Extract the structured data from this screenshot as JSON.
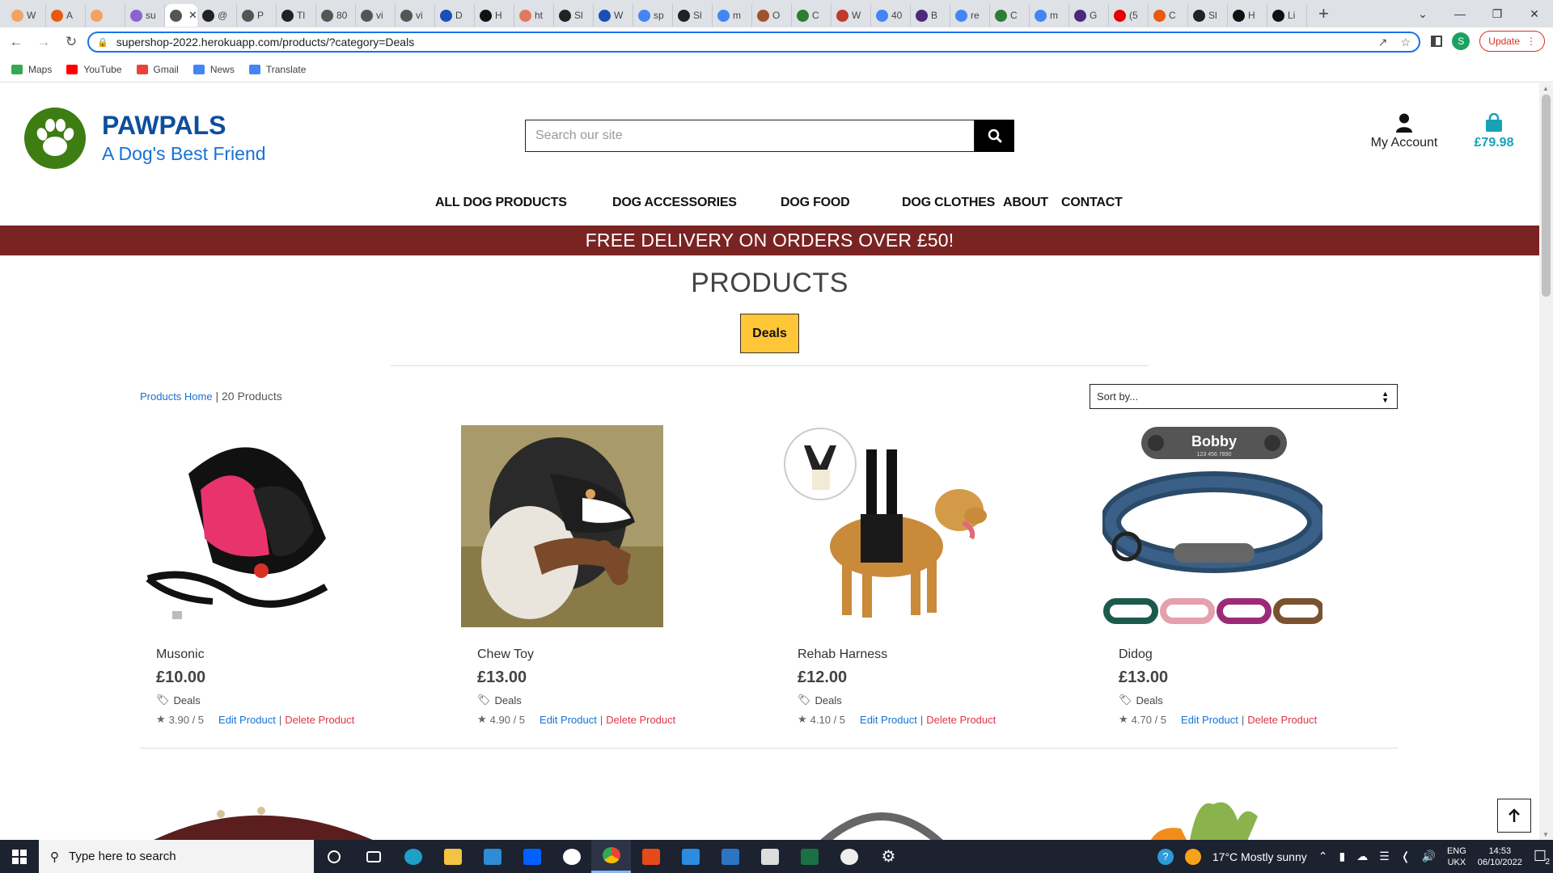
{
  "browser": {
    "tabs": [
      {
        "label": "W",
        "color": "#f4a261"
      },
      {
        "label": "A",
        "color": "#e8590c"
      },
      {
        "label": "",
        "color": "#f4a261"
      },
      {
        "label": "su",
        "color": "#8a63d2"
      },
      {
        "label": "",
        "color": "#555555",
        "active": true
      },
      {
        "label": "@",
        "color": "#222222"
      },
      {
        "label": "P",
        "color": "#555555"
      },
      {
        "label": "Tl",
        "color": "#222222"
      },
      {
        "label": "80",
        "color": "#555555"
      },
      {
        "label": "vi",
        "color": "#555555"
      },
      {
        "label": "vi",
        "color": "#555555"
      },
      {
        "label": "D",
        "color": "#1a4fb5"
      },
      {
        "label": "H",
        "color": "#111111"
      },
      {
        "label": "ht",
        "color": "#e07a5f"
      },
      {
        "label": "Sl",
        "color": "#222222"
      },
      {
        "label": "W",
        "color": "#1a4fb5"
      },
      {
        "label": "sp",
        "color": "#4285f4"
      },
      {
        "label": "Sl",
        "color": "#222222"
      },
      {
        "label": "m",
        "color": "#4285f4"
      },
      {
        "label": "O",
        "color": "#a0522d"
      },
      {
        "label": "C",
        "color": "#2e7d32"
      },
      {
        "label": "W",
        "color": "#c0392b"
      },
      {
        "label": "40",
        "color": "#4285f4"
      },
      {
        "label": "B",
        "color": "#4b2a7a"
      },
      {
        "label": "re",
        "color": "#4285f4"
      },
      {
        "label": "C",
        "color": "#2e7d32"
      },
      {
        "label": "m",
        "color": "#4285f4"
      },
      {
        "label": "G",
        "color": "#4b2a7a"
      },
      {
        "label": "(5",
        "color": "#e60000"
      },
      {
        "label": "C",
        "color": "#e8590c"
      },
      {
        "label": "Sl",
        "color": "#222222"
      },
      {
        "label": "H",
        "color": "#111111"
      },
      {
        "label": "Li",
        "color": "#111111"
      }
    ],
    "active_tab_close": "✕",
    "new_tab": "+",
    "window_controls": {
      "tab_search": "⌄",
      "minimize": "—",
      "maximize": "❐",
      "close": "✕"
    },
    "nav": {
      "back": "←",
      "forward": "→",
      "reload": "↻"
    },
    "url": "supershop-2022.herokuapp.com/products/?category=Deals",
    "profile_initial": "S",
    "update_label": "Update",
    "bookmarks": [
      {
        "label": "Maps",
        "color": "#34a853"
      },
      {
        "label": "YouTube",
        "color": "#ff0000"
      },
      {
        "label": "Gmail",
        "color": "#ea4335"
      },
      {
        "label": "News",
        "color": "#4285f4"
      },
      {
        "label": "Translate",
        "color": "#4285f4"
      }
    ]
  },
  "site": {
    "brand_name": "PAWPALS",
    "brand_tagline": "A Dog's Best Friend",
    "search_placeholder": "Search our site",
    "account_label": "My Account",
    "cart_total": "£79.98",
    "nav": [
      "ALL DOG PRODUCTS",
      "DOG ACCESSORIES",
      "DOG FOOD",
      "DOG CLOTHES",
      "ABOUT",
      "CONTACT"
    ],
    "banner": "FREE DELIVERY ON ORDERS OVER £50!",
    "heading": "PRODUCTS",
    "active_category": "Deals",
    "breadcrumb_link": "Products Home",
    "breadcrumb_sep": " | ",
    "product_count": "20 Products",
    "sort_label": "Sort by...",
    "edit_label": "Edit Product",
    "delete_label": "Delete Product",
    "products": [
      {
        "name": "Musonic",
        "price": "£10.00",
        "category": "Deals",
        "rating": "3.90 / 5"
      },
      {
        "name": "Chew Toy",
        "price": "£13.00",
        "category": "Deals",
        "rating": "4.90 / 5"
      },
      {
        "name": "Rehab Harness",
        "price": "£12.00",
        "category": "Deals",
        "rating": "4.10 / 5"
      },
      {
        "name": "Didog",
        "price": "£13.00",
        "category": "Deals",
        "rating": "4.70 / 5"
      }
    ],
    "collar_engraving": "Bobby",
    "collar_phone": "123 456 7890"
  },
  "taskbar": {
    "search_placeholder": "Type here to search",
    "weather": "17°C  Mostly sunny",
    "language": "ENG",
    "region": "UKX",
    "time": "14:53",
    "date": "06/10/2022",
    "notifications": "2"
  },
  "colors": {
    "brand_blue": "#0d4f9c",
    "tagline_blue": "#1771d6",
    "cart_teal": "#17a2b8",
    "banner_red": "#7a2323",
    "deals_yellow": "#ffc637",
    "delete_red": "#dc3545"
  }
}
